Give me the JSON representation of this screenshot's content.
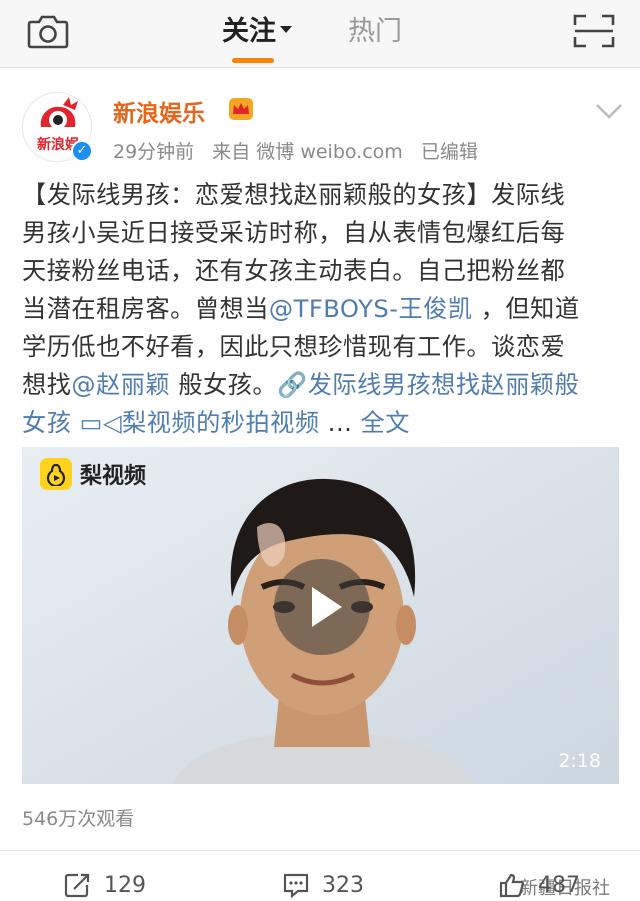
{
  "nav": {
    "tab_follow": "关注",
    "tab_hot": "热门",
    "camera_icon": "camera-icon",
    "scan_icon": "scan-icon"
  },
  "post": {
    "author": "新浪娱乐",
    "avatar_text": "新浪娱",
    "time": "29分钟前",
    "source": "来自 微博 weibo.com",
    "edited": "已编辑",
    "text_lines": [
      [
        {
          "t": "【发际线男孩：恋爱想找赵丽颖般的女孩】发际线",
          "link": false
        }
      ],
      [
        {
          "t": "男孩小吴近日接受采访时称，自从表情包爆红后每",
          "link": false
        }
      ],
      [
        {
          "t": "天接粉丝电话，还有女孩主动表白。自己把粉丝都",
          "link": false
        }
      ],
      [
        {
          "t": "当潜在租房客。曾想当",
          "link": false
        },
        {
          "t": "@TFBOYS-王俊凯",
          "link": true
        },
        {
          "t": " ，但知道",
          "link": false
        }
      ],
      [
        {
          "t": "学历低也不好看，因此只想珍惜现有工作。谈恋爱",
          "link": false
        }
      ],
      [
        {
          "t": "想找",
          "link": false
        },
        {
          "t": "@赵丽颖",
          "link": true
        },
        {
          "t": " 般女孩。",
          "link": false
        },
        {
          "t": "🔗发际线男孩想找赵丽颖般",
          "link": true
        }
      ],
      [
        {
          "t": "女孩",
          "link": true
        },
        {
          "t": " ",
          "link": false
        },
        {
          "t": "▭◁梨视频的秒拍视频",
          "link": true
        },
        {
          "t": "  ... ",
          "link": false
        },
        {
          "t": "全文",
          "link": true
        }
      ]
    ]
  },
  "video": {
    "brand": "梨视频",
    "duration": "2:18",
    "views": "546万次观看"
  },
  "actions": {
    "repost": "129",
    "comment": "323",
    "like": "487"
  },
  "watermark": "新疆日报社",
  "colors": {
    "accent": "#ff8200",
    "author": "#e3661a",
    "link": "#507daf",
    "verified": "#1e8ff0"
  }
}
